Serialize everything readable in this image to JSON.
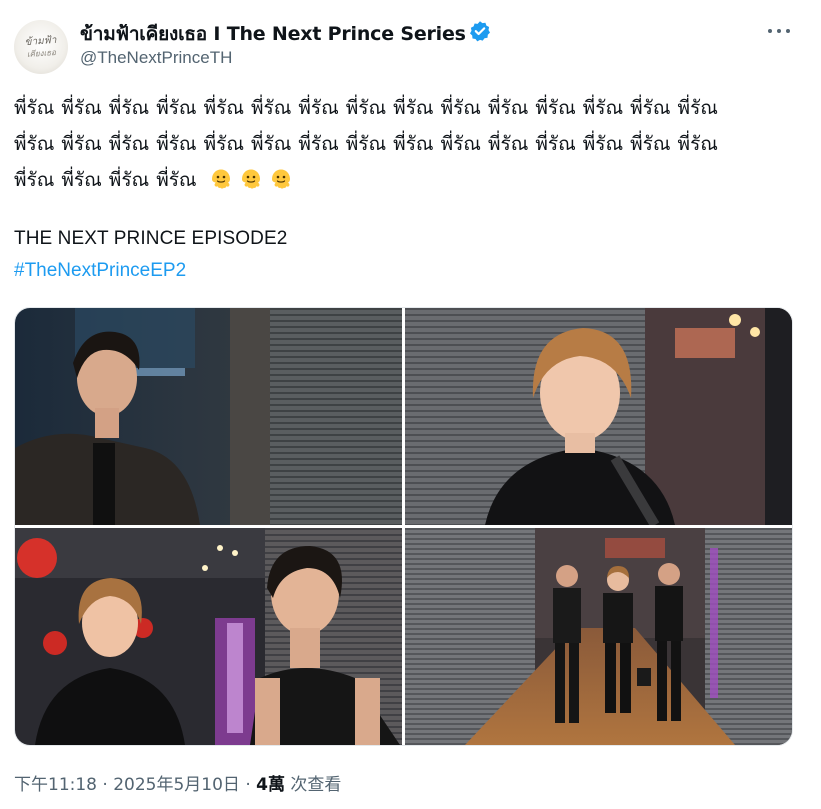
{
  "author": {
    "display_name": "ข้ามฟ้าเคียงเธอ I The Next Prince Series",
    "handle": "@TheNextPrinceTH",
    "verified": true,
    "avatar_logo_text": "ข้ามฟ้า เคียงเธอ"
  },
  "post": {
    "line1": "พี่รัณ พี่รัณ พี่รัณ พี่รัณ พี่รัณ พี่รัณ พี่รัณ พี่รัณ พี่รัณ พี่รัณ พี่รัณ พี่รัณ พี่รัณ พี่รัณ พี่รัณ",
    "line2": "พี่รัณ พี่รัณ พี่รัณ พี่รัณ พี่รัณ พี่รัณ พี่รัณ พี่รัณ พี่รัณ พี่รัณ พี่รัณ พี่รัณ พี่รัณ พี่รัณ พี่รัณ",
    "line3": "พี่รัณ พี่รัณ พี่รัณ พี่รัณ",
    "emoji_name": "melting-face-emoji",
    "emoji_count": 3,
    "episode_title": "THE NEXT PRINCE EPISODE2",
    "hashtag": "#TheNextPrinceEP2"
  },
  "media": {
    "photo_count": 4
  },
  "meta": {
    "time": "下午11:18",
    "separator": "·",
    "date": "2025年5月10日",
    "views_count": "4萬",
    "views_label": "次查看"
  },
  "colors": {
    "text": "#0f1419",
    "secondary": "#536471",
    "link": "#1d9bf0",
    "verified": "#1d9bf0"
  }
}
